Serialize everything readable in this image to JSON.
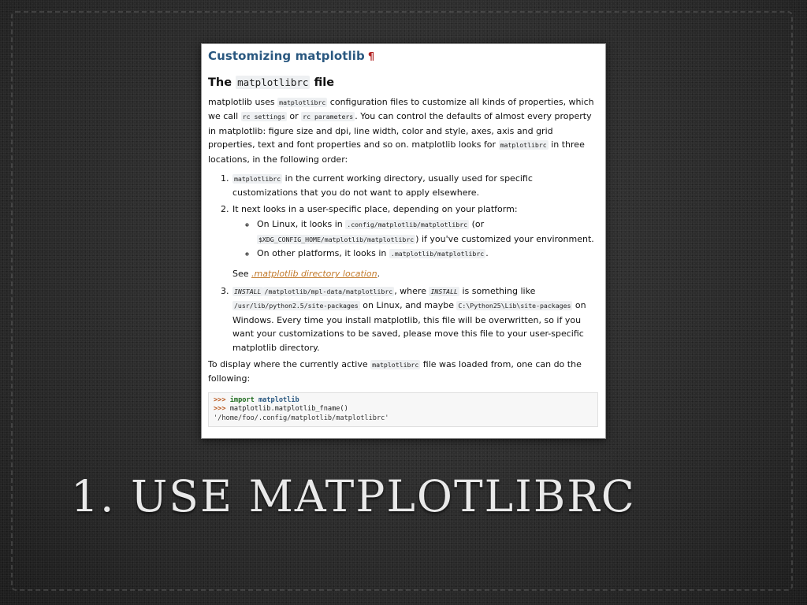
{
  "doc": {
    "title": "Customizing matplotlib",
    "pilcrow": "¶",
    "subtitle_pre": "The ",
    "subtitle_code": "matplotlibrc",
    "subtitle_post": " file",
    "intro": {
      "t1": "matplotlib uses ",
      "c1": "matplotlibrc",
      "t2": " configuration files to customize all kinds of properties, which we call ",
      "c2": "rc settings",
      "t3": " or ",
      "c3": "rc parameters",
      "t4": ". You can control the defaults of almost every property in matplotlib: figure size and dpi, line width, color and style, axes, axis and grid properties, text and font properties and so on. matplotlib looks for ",
      "c4": "matplotlibrc",
      "t5": " in three locations, in the following order:"
    },
    "item1": {
      "c1": "matplotlibrc",
      "t1": " in the current working directory, usually used for specific customizations that you do not want to apply elsewhere."
    },
    "item2": {
      "t1": "It next looks in a user-specific place, depending on your platform:",
      "sub1_t1": "On Linux, it looks in ",
      "sub1_c1": ".config/matplotlib/matplotlibrc",
      "sub1_t2": " (or ",
      "sub1_c2": "$XDG_CONFIG_HOME/matplotlib/matplotlibrc",
      "sub1_t3": ") if you've customized your environment.",
      "sub2_t1": "On other platforms, it looks in ",
      "sub2_c1": ".matplotlib/matplotlibrc",
      "sub2_t2": ".",
      "see_t1": "See ",
      "see_link": ".matplotlib directory location",
      "see_t2": "."
    },
    "item3": {
      "c1": "INSTALL",
      "c2": "/matplotlib/mpl-data/matplotlibrc",
      "t1": ", where ",
      "c3": "INSTALL",
      "t2": " is something like ",
      "c4": "/usr/lib/python2.5/site-packages",
      "t3": " on Linux, and maybe ",
      "c5": "C:\\Python25\\Lib\\site-packages",
      "t4": " on Windows. Every time you install matplotlib, this file will be overwritten, so if you want your customizations to be saved, please move this file to your user-specific matplotlib directory."
    },
    "outro": {
      "t1": "To display where the currently active ",
      "c1": "matplotlibrc",
      "t2": " file was loaded from, one can do the following:"
    },
    "code": {
      "prompt": ">>>",
      "l1_kw": "import",
      "l1_mod": "matplotlib",
      "l2": "matplotlib.matplotlib_fname()",
      "l3": "'/home/foo/.config/matplotlib/matplotlibrc'"
    }
  },
  "slide": {
    "title": "1. USE MATPLOTLIBRC"
  }
}
